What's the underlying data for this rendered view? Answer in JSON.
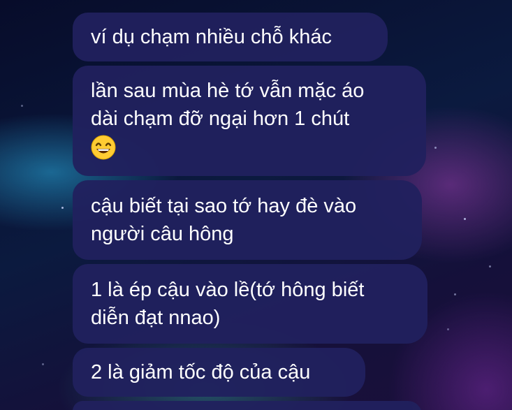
{
  "messages": [
    {
      "text": "ví dụ chạm nhiều chỗ khác"
    },
    {
      "text": "lần sau mùa hè tớ vẫn mặc áo\ndài chạm đỡ ngại hơn 1 chút",
      "emoji": "grinning-face-smiling-eyes"
    },
    {
      "text": "cậu biết tại sao tớ hay đè vào\nngười câu hông"
    },
    {
      "text": "1 là ép cậu vào lề(tớ hông biết\ndiễn đạt nnao)"
    },
    {
      "text": "2 là giảm tốc độ của cậu"
    },
    {
      "text": ""
    }
  ],
  "colors": {
    "bubble": "#21215e",
    "text": "#ffffff",
    "background": "#0b1a3f"
  }
}
